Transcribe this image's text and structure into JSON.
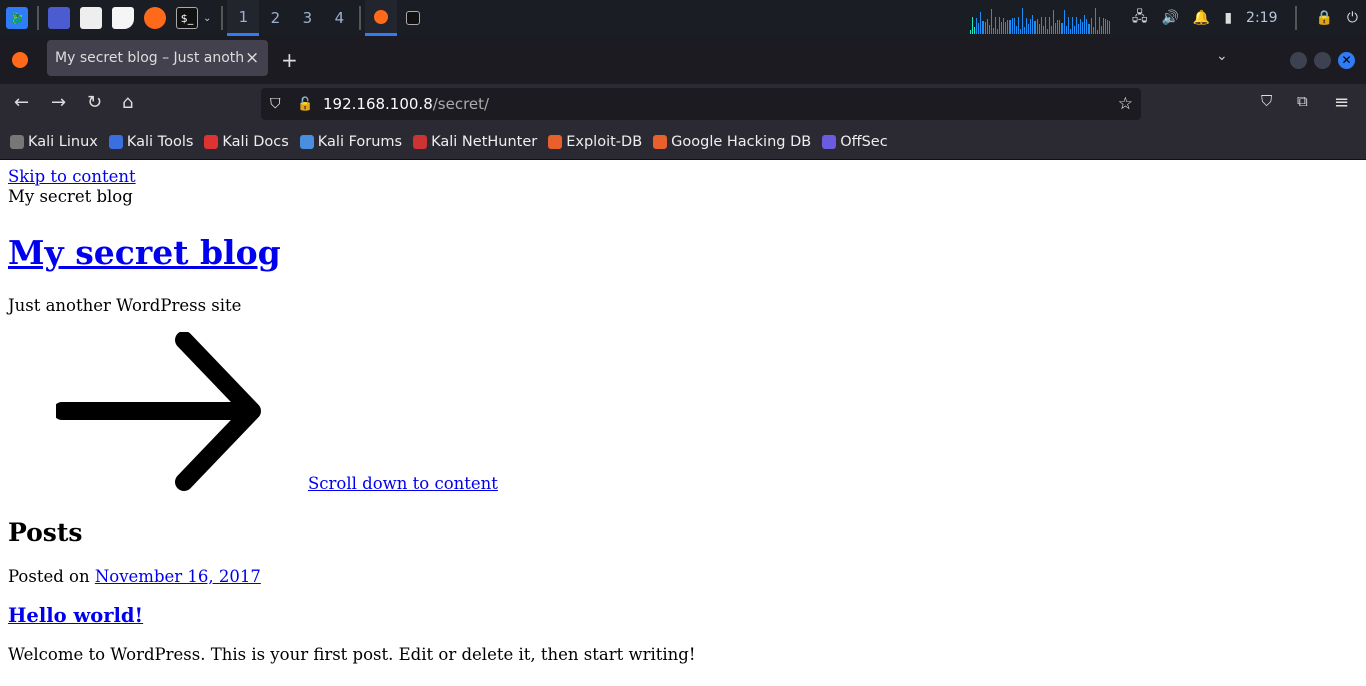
{
  "taskbar": {
    "workspaces": [
      "1",
      "2",
      "3",
      "4"
    ],
    "clock": "2:19"
  },
  "tab": {
    "title": "My secret blog – Just another WordPress site",
    "close": "×",
    "new_tab": "+"
  },
  "navbar": {
    "url_host": "192.168.100.8",
    "url_path": "/secret/"
  },
  "bookmarks": [
    {
      "label": "Kali Linux",
      "color": "#777"
    },
    {
      "label": "Kali Tools",
      "color": "#3b6fe0"
    },
    {
      "label": "Kali Docs",
      "color": "#d33"
    },
    {
      "label": "Kali Forums",
      "color": "#4a8ee0"
    },
    {
      "label": "Kali NetHunter",
      "color": "#c33"
    },
    {
      "label": "Exploit-DB",
      "color": "#e8602c"
    },
    {
      "label": "Google Hacking DB",
      "color": "#e8602c"
    },
    {
      "label": "OffSec",
      "color": "#6a5be0"
    }
  ],
  "page": {
    "skip_link": "Skip to content",
    "site_name": "My secret blog",
    "site_title": "My secret blog",
    "tagline": "Just another WordPress site",
    "scroll_link": "Scroll down to content",
    "posts_heading": "Posts",
    "posted_on": "Posted on ",
    "post_date": "November 16, 2017",
    "post_title": "Hello world!",
    "post_excerpt": "Welcome to WordPress. This is your first post. Edit or delete it, then start writing!"
  }
}
